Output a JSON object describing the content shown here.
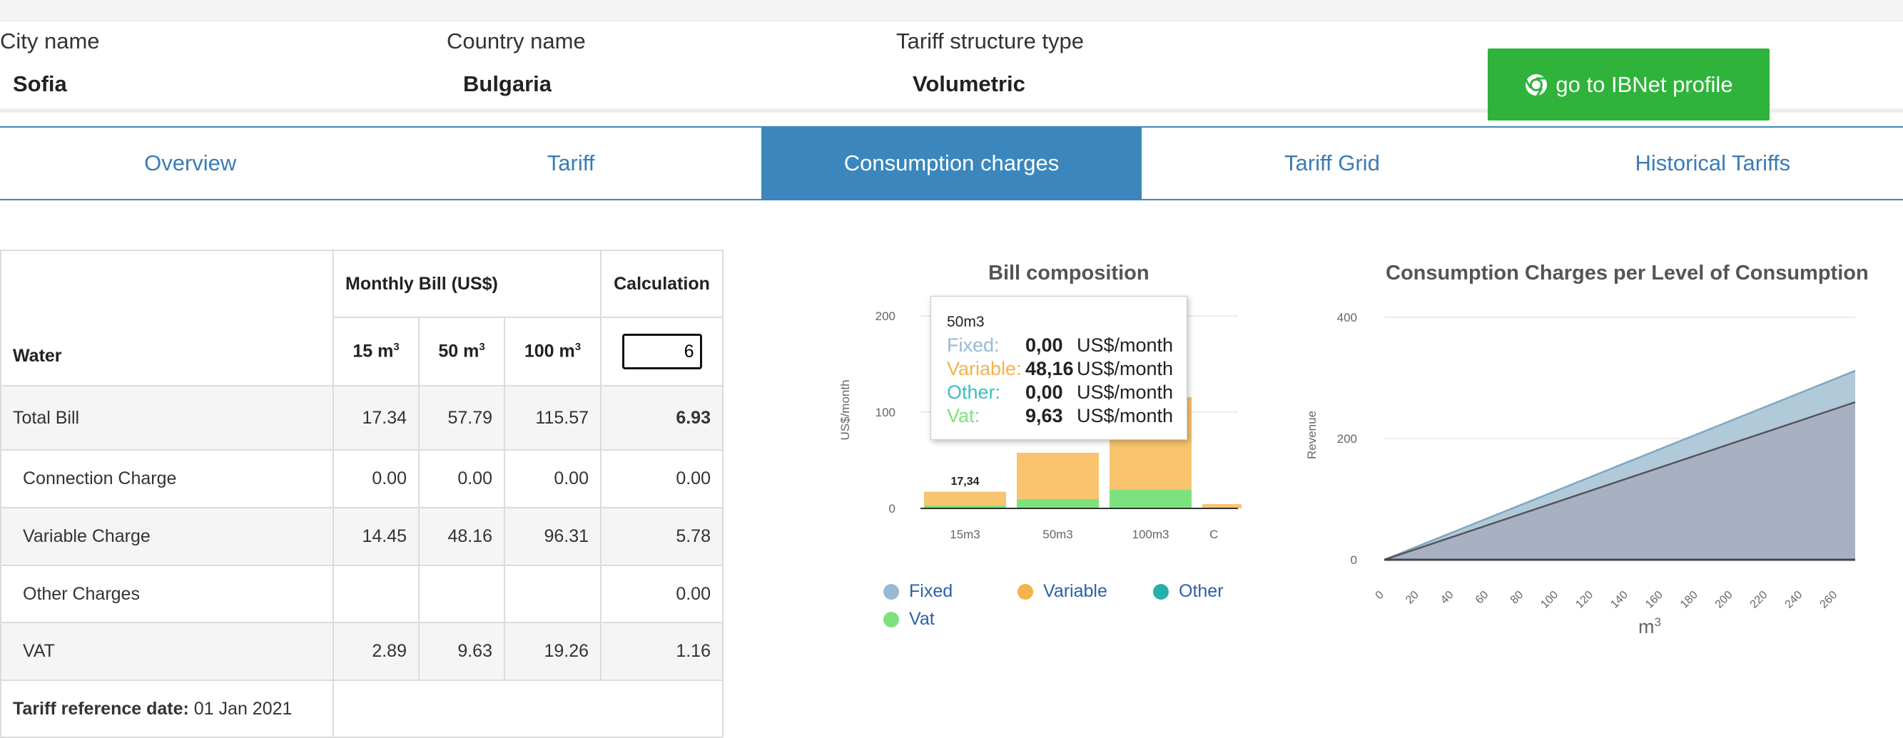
{
  "header": {
    "city_label": "City name",
    "city_value": "Sofia",
    "country_label": "Country name",
    "country_value": "Bulgaria",
    "tariff_label": "Tariff structure type",
    "tariff_value": "Volumetric",
    "ibnet_button": "go to IBNet profile",
    "ibnet_button_color": "#2fb33b"
  },
  "tabs": [
    {
      "label": "Overview"
    },
    {
      "label": "Tariff"
    },
    {
      "label": "Consumption charges",
      "active": true
    },
    {
      "label": "Tariff Grid"
    },
    {
      "label": "Historical Tariffs"
    }
  ],
  "table": {
    "monthly_bill_header": "Monthly Bill (US$)",
    "calculation_header": "Calculation",
    "water_label": "Water",
    "col_15": "15 m",
    "col_50": "50 m",
    "col_100": "100 m",
    "sup": "3",
    "calc_input_value": "6",
    "rows": [
      {
        "label": "Total Bill",
        "v15": "17.34",
        "v50": "57.79",
        "v100": "115.57",
        "calc": "6.93"
      },
      {
        "label": "Connection Charge",
        "v15": "0.00",
        "v50": "0.00",
        "v100": "0.00",
        "calc": "0.00"
      },
      {
        "label": "Variable Charge",
        "v15": "14.45",
        "v50": "48.16",
        "v100": "96.31",
        "calc": "5.78"
      },
      {
        "label": "Other Charges",
        "v15": "",
        "v50": "",
        "v100": "",
        "calc": "0.00"
      },
      {
        "label": "VAT",
        "v15": "2.89",
        "v50": "9.63",
        "v100": "19.26",
        "calc": "1.16"
      }
    ],
    "ref_date_label": "Tariff reference date:",
    "ref_date_value": "01 Jan 2021"
  },
  "bill_chart": {
    "title": "Bill composition",
    "ylabel": "US$/month",
    "yticks": [
      "0",
      "100",
      "200"
    ],
    "tooltip": {
      "title": "50m3",
      "rows": [
        {
          "key": "Fixed:",
          "value": "0,00",
          "unit": "US$/month",
          "color": "#97b9d3"
        },
        {
          "key": "Variable:",
          "value": "48,16",
          "unit": "US$/month",
          "color": "#f6b24c"
        },
        {
          "key": "Other:",
          "value": "0,00",
          "unit": "US$/month",
          "color": "#3cbfc0"
        },
        {
          "key": "Vat:",
          "value": "9,63",
          "unit": "US$/month",
          "color": "#7de27d"
        }
      ]
    },
    "legend": [
      {
        "label": "Fixed",
        "color": "#97b9d3"
      },
      {
        "label": "Variable",
        "color": "#f6b24c"
      },
      {
        "label": "Other",
        "color": "#26b0a8"
      },
      {
        "label": "Vat",
        "color": "#7de27d"
      }
    ],
    "total_labels": [
      "17,34"
    ],
    "clipped_category_label": "C"
  },
  "consumption_chart": {
    "title": "Consumption Charges per Level of Consumption",
    "ylabel": "Revenue",
    "xlabel": "m",
    "xlabel_sup": "3",
    "yticks": [
      "0",
      "200",
      "400"
    ],
    "xticks": [
      "0",
      "20",
      "40",
      "60",
      "80",
      "100",
      "120",
      "140",
      "160",
      "180",
      "200",
      "220",
      "240",
      "260"
    ]
  },
  "chart_data": [
    {
      "type": "bar",
      "title": "Bill composition",
      "ylabel": "US$/month",
      "ylim": [
        0,
        200
      ],
      "stacked": true,
      "categories": [
        "15m3",
        "50m3",
        "100m3"
      ],
      "series": [
        {
          "name": "Fixed",
          "values": [
            0.0,
            0.0,
            0.0
          ],
          "color": "#97b9d3"
        },
        {
          "name": "Variable",
          "values": [
            14.45,
            48.16,
            96.31
          ],
          "color": "#f8c46e"
        },
        {
          "name": "Other",
          "values": [
            0.0,
            0.0,
            0.0
          ],
          "color": "#3cbfc0"
        },
        {
          "name": "Vat",
          "values": [
            2.89,
            9.63,
            19.26
          ],
          "color": "#7de27d"
        }
      ]
    },
    {
      "type": "area",
      "title": "Consumption Charges per Level of Consumption",
      "xlabel": "m3",
      "ylabel": "Revenue",
      "xlim": [
        0,
        270
      ],
      "ylim": [
        0,
        400
      ],
      "x": [
        0,
        270
      ],
      "series": [
        {
          "name": "Total",
          "values": [
            0,
            311.8
          ],
          "color": "#a8c4d6"
        },
        {
          "name": "Variable",
          "values": [
            0,
            260.0
          ],
          "color": "#a7aec1"
        },
        {
          "name": "Fixed",
          "values": [
            0,
            0
          ],
          "color": "#444444"
        }
      ]
    }
  ]
}
